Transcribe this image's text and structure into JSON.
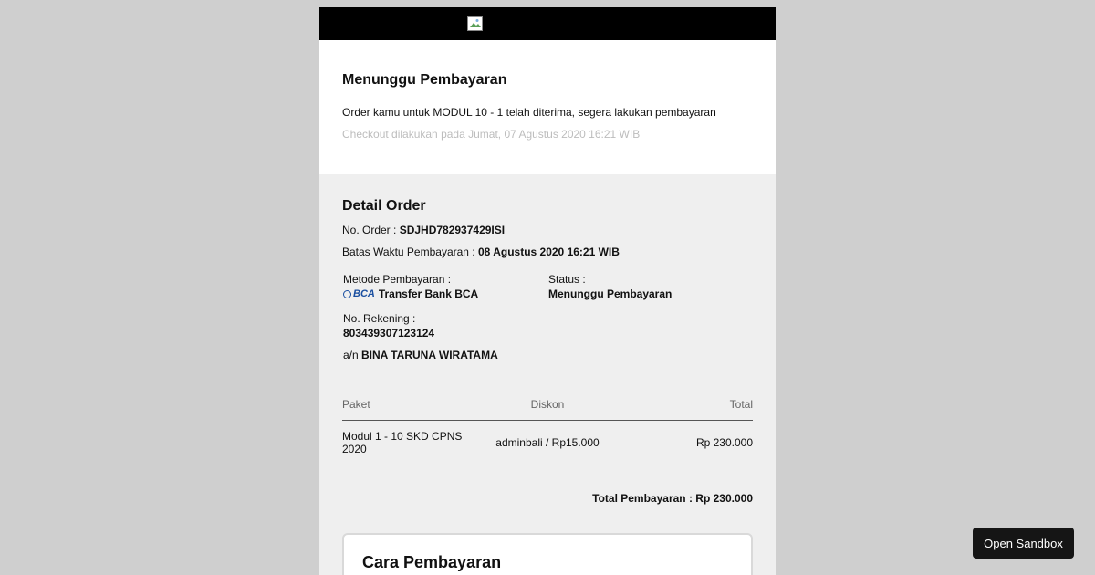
{
  "header": {
    "logo_icon": "broken-image-icon"
  },
  "top": {
    "title": "Menunggu Pembayaran",
    "description": "Order kamu untuk MODUL 10 - 1 telah diterima, segera lakukan pembayaran",
    "checkout": "Checkout dilakukan pada Jumat, 07 Agustus 2020 16:21 WIB"
  },
  "detail": {
    "title": "Detail Order",
    "order_label": "No. Order : ",
    "order_value": "SDJHD782937429ISI",
    "deadline_label": "Batas Waktu Pembayaran : ",
    "deadline_value": "08 Agustus 2020 16:21 WIB",
    "method_label": "Metode Pembayaran :",
    "bank_logo": "BCA",
    "method_value": "Transfer Bank BCA",
    "status_label": "Status :",
    "status_value": "Menunggu Pembayaran",
    "account_label": "No. Rekening :",
    "account_value": "803439307123124",
    "holder_prefix": "a/n ",
    "holder_value": "BINA TARUNA WIRATAMA"
  },
  "table": {
    "headers": [
      "Paket",
      "Diskon",
      "Total"
    ],
    "rows": [
      {
        "paket": "Modul 1 - 10 SKD CPNS 2020",
        "diskon": "adminbali / Rp15.000",
        "total": "Rp 230.000"
      }
    ]
  },
  "total_payment": "Total Pembayaran : Rp 230.000",
  "cara": {
    "title": "Cara Pembayaran"
  },
  "sandbox": {
    "label": "Open Sandbox"
  },
  "colors": {
    "background": "#cfcfcf",
    "header": "#000000",
    "bca_blue": "#1a4fa0"
  }
}
